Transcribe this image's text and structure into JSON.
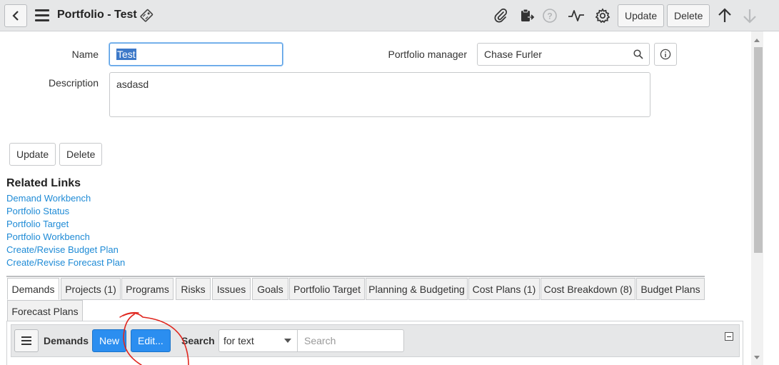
{
  "header": {
    "title": "Portfolio - Test",
    "update_label": "Update",
    "delete_label": "Delete"
  },
  "form": {
    "name_label": "Name",
    "name_value": "Test",
    "portfolio_manager_label": "Portfolio manager",
    "portfolio_manager_value": "Chase Furler",
    "description_label": "Description",
    "description_value": "asdasd",
    "update_label": "Update",
    "delete_label": "Delete"
  },
  "related_links": {
    "title": "Related Links",
    "items": [
      "Demand Workbench",
      "Portfolio Status",
      "Portfolio Target",
      "Portfolio Workbench",
      "Create/Revise Budget Plan",
      "Create/Revise Forecast Plan"
    ]
  },
  "tabs": [
    "Demands",
    "Projects (1)",
    "Programs",
    "Risks",
    "Issues",
    "Goals",
    "Portfolio Target",
    "Planning & Budgeting",
    "Cost Plans (1)",
    "Cost Breakdown (8)",
    "Budget Plans",
    "Forecast Plans"
  ],
  "active_tab": "Demands",
  "related_list": {
    "title": "Demands",
    "new_label": "New",
    "edit_label": "Edit...",
    "search_label": "Search",
    "search_select_value": "for text",
    "search_placeholder": "Search"
  },
  "colors": {
    "header_bg": "#e6e7e8",
    "link": "#1f8bd6",
    "primary_button": "#2b8ef0",
    "annotation": "#e0261e",
    "selection": "#3c78c8"
  },
  "icons": [
    "back-icon",
    "menu-icon",
    "tag-icon",
    "paperclip-icon",
    "clipboard-icon",
    "help-icon",
    "activity-icon",
    "gear-icon",
    "arrow-up-icon",
    "arrow-down-icon",
    "search-icon",
    "info-icon",
    "collapse-icon"
  ]
}
